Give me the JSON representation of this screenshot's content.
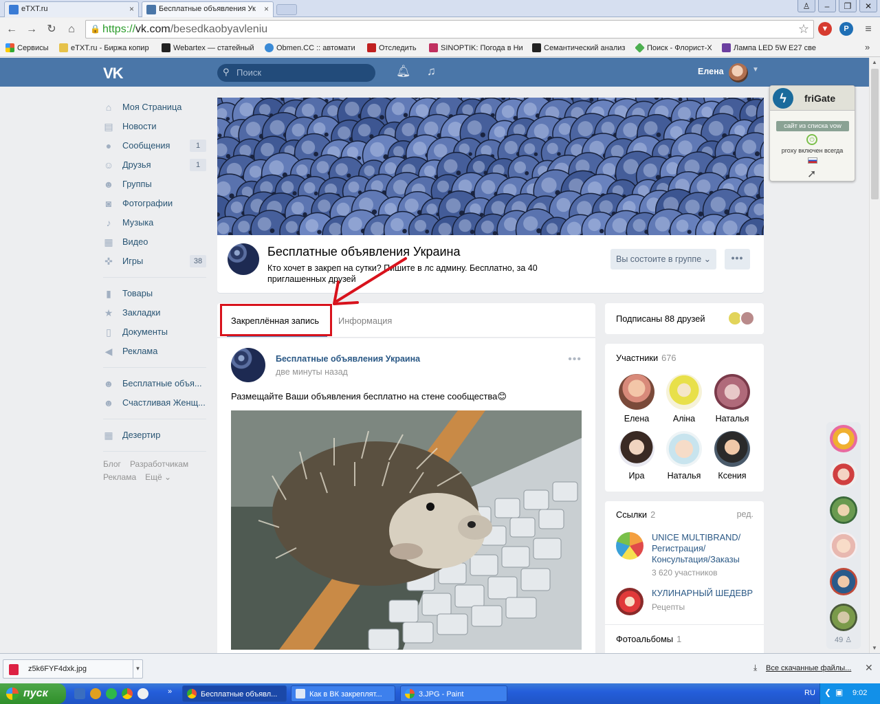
{
  "browser": {
    "tabs": [
      {
        "title": "eTXT.ru",
        "active": false
      },
      {
        "title": "Бесплатные объявления Ук",
        "active": true
      }
    ],
    "url_scheme": "https://",
    "url_host": "vk.com",
    "url_path": "/besedkaobyavleniu",
    "bookmarks": [
      "Сервисы",
      "eTXT.ru - Биржа копир",
      "Webartex — статейный",
      "Obmen.CC :: автомати",
      "Отследить",
      "SINOPTIK: Погода в Ни",
      "Семантический анализ",
      "Поиск - Флорист-Х",
      "Лампа LED 5W E27 све"
    ]
  },
  "vk_header": {
    "logo": "VK",
    "search_placeholder": "Поиск",
    "user_name": "Елена"
  },
  "menu": {
    "items": [
      {
        "label": "Моя Страница",
        "icon": "home-icon",
        "count": ""
      },
      {
        "label": "Новости",
        "icon": "news-icon",
        "count": ""
      },
      {
        "label": "Сообщения",
        "icon": "messages-icon",
        "count": "1"
      },
      {
        "label": "Друзья",
        "icon": "friends-icon",
        "count": "1"
      },
      {
        "label": "Группы",
        "icon": "groups-icon",
        "count": ""
      },
      {
        "label": "Фотографии",
        "icon": "camera-icon",
        "count": ""
      },
      {
        "label": "Музыка",
        "icon": "music-icon",
        "count": ""
      },
      {
        "label": "Видео",
        "icon": "video-icon",
        "count": ""
      },
      {
        "label": "Игры",
        "icon": "gamepad-icon",
        "count": "38"
      }
    ],
    "items2": [
      {
        "label": "Товары",
        "icon": "bag-icon"
      },
      {
        "label": "Закладки",
        "icon": "star-icon"
      },
      {
        "label": "Документы",
        "icon": "document-icon"
      },
      {
        "label": "Реклама",
        "icon": "megaphone-icon"
      }
    ],
    "groups": [
      {
        "label": "Бесплатные объя..."
      },
      {
        "label": "Счастливая Женщ..."
      }
    ],
    "apps": [
      {
        "label": "Дезертир"
      }
    ],
    "footer": [
      "Блог",
      "Разработчикам",
      "Реклама",
      "Ещё ⌄"
    ]
  },
  "group": {
    "title": "Бесплатные объявления Украина",
    "status": "Кто хочет в закреп на сутки? Пишите в лс админу. Бесплатно, за 40 приглашенных друзей",
    "member_button": "Вы состоите в группе ⌄",
    "more": "•••"
  },
  "feed": {
    "tabs": [
      "Закреплённая запись",
      "Информация"
    ],
    "post": {
      "author": "Бесплатные объявления Украина",
      "time": "две минуты назад",
      "text": "Размещайте Ваши объявления бесплатно на стене сообщества😊",
      "dots": "•••"
    }
  },
  "right": {
    "subscribed": "Подписаны 88 друзей",
    "members_title": "Участники",
    "members_count": "676",
    "members": [
      "Елена",
      "Аліна",
      "Наталья",
      "Ира",
      "Наталья",
      "Ксения"
    ],
    "links_title": "Ссылки",
    "links_count": "2",
    "links_edit": "ред.",
    "links": [
      {
        "title": "UNICE MULTIBRAND/ Регистрация/ Консультация/Заказы",
        "sub": "3 620 участников"
      },
      {
        "title": "КУЛИНАРНЫЙ ШЕДЕВР",
        "sub": "Рецепты"
      }
    ],
    "albums_title": "Фотоальбомы",
    "albums_count": "1"
  },
  "frigate": {
    "name": "friGate",
    "tag": "сайт из списка vow",
    "proxy": "proxy включен всегда"
  },
  "rail": {
    "count": "49"
  },
  "downloads": {
    "file": "z5k6FYF4dxk.jpg",
    "all": "Все скачанные файлы..."
  },
  "taskbar": {
    "start": "пуск",
    "tasks": [
      "Бесплатные объявл...",
      "Как в ВК закреплят...",
      "3.JPG - Paint"
    ],
    "lang": "RU",
    "clock": "9:02"
  }
}
